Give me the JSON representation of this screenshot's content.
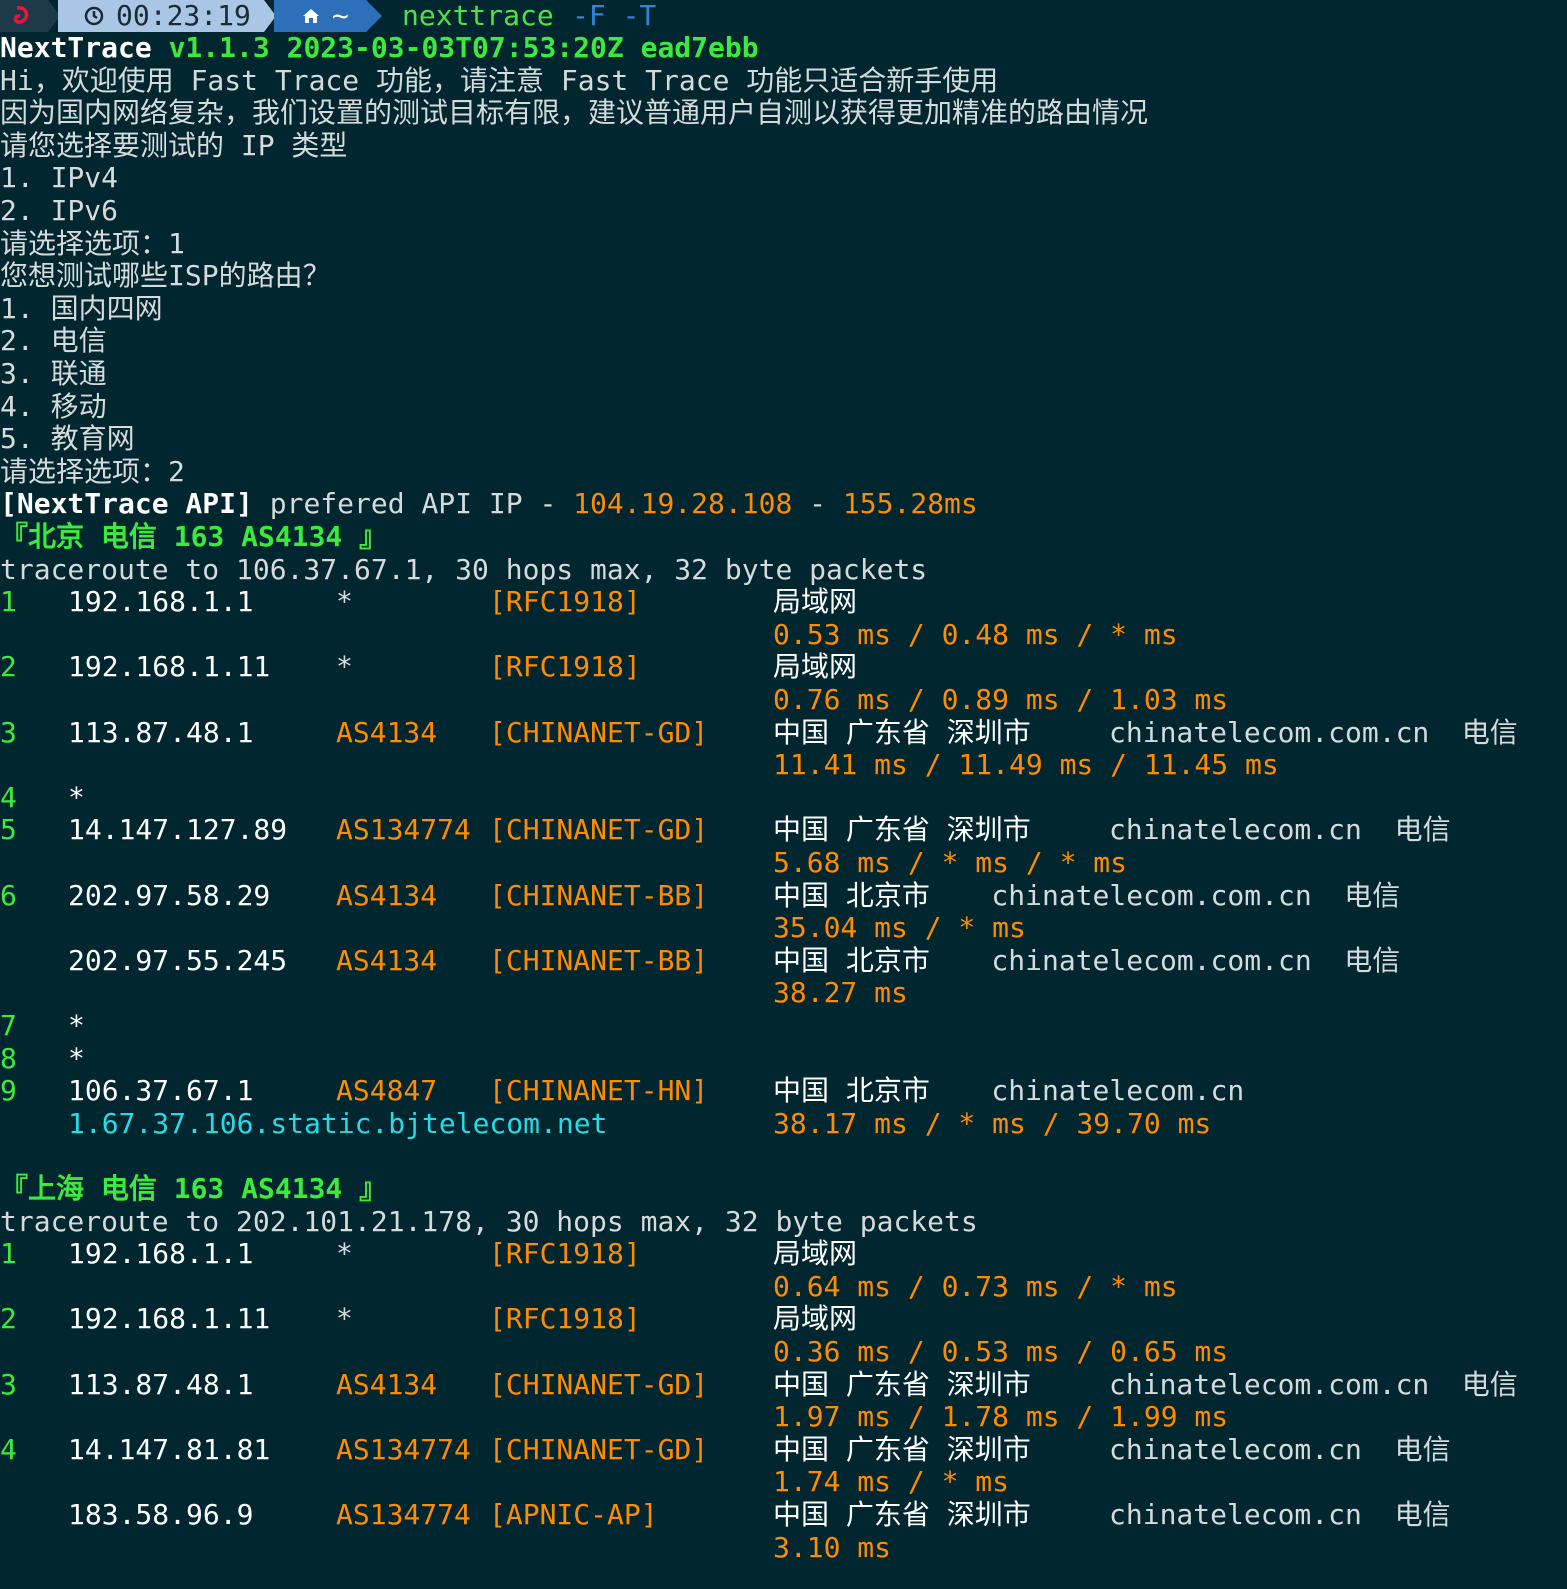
{
  "prompt": {
    "time": "00:23:19",
    "dir": "~",
    "command": "nexttrace",
    "args": "-F -T"
  },
  "colors": {
    "background": "#00262f",
    "green": "#3ee93e",
    "orange": "#ff8c00",
    "cyan": "#29d9e3",
    "prompt_time_bg": "#a9c7e4",
    "prompt_dir_bg": "#2d6fb8"
  },
  "icons": {
    "os": "debian-swirl-icon",
    "clock": "clock-icon",
    "home": "home-icon"
  },
  "header": {
    "app": "NextTrace",
    "version": "v1.1.3 2023-03-03T07:53:20Z ead7ebb"
  },
  "intro": [
    "Hi，欢迎使用 Fast Trace 功能，请注意 Fast Trace 功能只适合新手使用",
    "因为国内网络复杂，我们设置的测试目标有限，建议普通用户自测以获得更加精准的路由情况",
    "请您选择要测试的 IP 类型",
    "1. IPv4",
    "2. IPv6",
    "请选择选项：1",
    "您想测试哪些ISP的路由？",
    "1. 国内四网",
    "2. 电信",
    "3. 联通",
    "4. 移动",
    "5. 教育网",
    "请选择选项：2"
  ],
  "api": {
    "prefix": "[NextTrace API]",
    "text": " prefered API IP - ",
    "ip": "104.19.28.108",
    "sep": " - ",
    "latency": "155.28ms"
  },
  "sections": [
    {
      "title": "『北京 电信 163 AS4134 』",
      "traceroute": "traceroute to 106.37.67.1, 30 hops max, 32 byte packets",
      "rows": [
        {
          "hop": "1",
          "ip": "192.168.1.1",
          "asn": "*",
          "asn_plain": true,
          "net": "[RFC1918]",
          "geo": "局域网",
          "domain": "",
          "isp": "",
          "rtt": "0.53 ms / 0.48 ms / * ms"
        },
        {
          "hop": "2",
          "ip": "192.168.1.11",
          "asn": "*",
          "asn_plain": true,
          "net": "[RFC1918]",
          "geo": "局域网",
          "domain": "",
          "isp": "",
          "rtt": "0.76 ms / 0.89 ms / 1.03 ms"
        },
        {
          "hop": "3",
          "ip": "113.87.48.1",
          "asn": "AS4134",
          "net": "[CHINANET-GD]",
          "geo": "中国 广东省 深圳市",
          "domain": "chinatelecom.com.cn",
          "isp": "电信",
          "rtt": "11.41 ms / 11.49 ms / 11.45 ms"
        },
        {
          "hop": "4",
          "ip": "*",
          "asn": "",
          "net": "",
          "geo": "",
          "domain": "",
          "isp": "",
          "rtt": ""
        },
        {
          "hop": "5",
          "ip": "14.147.127.89",
          "asn": "AS134774",
          "net": "[CHINANET-GD]",
          "geo": "中国 广东省 深圳市",
          "domain": "chinatelecom.cn",
          "isp": "电信",
          "rtt": "5.68 ms / * ms / * ms"
        },
        {
          "hop": "6",
          "ip": "202.97.58.29",
          "asn": "AS4134",
          "net": "[CHINANET-BB]",
          "geo": "中国 北京市",
          "domain": "chinatelecom.com.cn",
          "isp": "电信",
          "rtt": "35.04 ms / * ms"
        },
        {
          "hop": "",
          "ip": "202.97.55.245",
          "asn": "AS4134",
          "net": "[CHINANET-BB]",
          "geo": "中国 北京市",
          "domain": "chinatelecom.com.cn",
          "isp": "电信",
          "rtt": "38.27 ms"
        },
        {
          "hop": "7",
          "ip": "*",
          "asn": "",
          "net": "",
          "geo": "",
          "domain": "",
          "isp": "",
          "rtt": ""
        },
        {
          "hop": "8",
          "ip": "*",
          "asn": "",
          "net": "",
          "geo": "",
          "domain": "",
          "isp": "",
          "rtt": ""
        },
        {
          "hop": "9",
          "ip": "106.37.67.1",
          "asn": "AS4847",
          "net": "[CHINANET-HN]",
          "geo": "中国 北京市",
          "domain": "chinatelecom.cn",
          "isp": "",
          "rtt": "38.17 ms / * ms / 39.70 ms",
          "hostname": "1.67.37.106.static.bjtelecom.net"
        }
      ]
    },
    {
      "title": "『上海 电信 163 AS4134 』",
      "traceroute": "traceroute to 202.101.21.178, 30 hops max, 32 byte packets",
      "rows": [
        {
          "hop": "1",
          "ip": "192.168.1.1",
          "asn": "*",
          "asn_plain": true,
          "net": "[RFC1918]",
          "geo": "局域网",
          "domain": "",
          "isp": "",
          "rtt": "0.64 ms / 0.73 ms / * ms"
        },
        {
          "hop": "2",
          "ip": "192.168.1.11",
          "asn": "*",
          "asn_plain": true,
          "net": "[RFC1918]",
          "geo": "局域网",
          "domain": "",
          "isp": "",
          "rtt": "0.36 ms / 0.53 ms / 0.65 ms"
        },
        {
          "hop": "3",
          "ip": "113.87.48.1",
          "asn": "AS4134",
          "net": "[CHINANET-GD]",
          "geo": "中国 广东省 深圳市",
          "domain": "chinatelecom.com.cn",
          "isp": "电信",
          "rtt": "1.97 ms / 1.78 ms / 1.99 ms"
        },
        {
          "hop": "4",
          "ip": "14.147.81.81",
          "asn": "AS134774",
          "net": "[CHINANET-GD]",
          "geo": "中国 广东省 深圳市",
          "domain": "chinatelecom.cn",
          "isp": "电信",
          "rtt": "1.74 ms / * ms"
        },
        {
          "hop": "",
          "ip": "183.58.96.9",
          "asn": "AS134774",
          "net": "[APNIC-AP]",
          "geo": "中国 广东省 深圳市",
          "domain": "chinatelecom.cn",
          "isp": "电信",
          "rtt": "3.10 ms"
        }
      ]
    }
  ]
}
